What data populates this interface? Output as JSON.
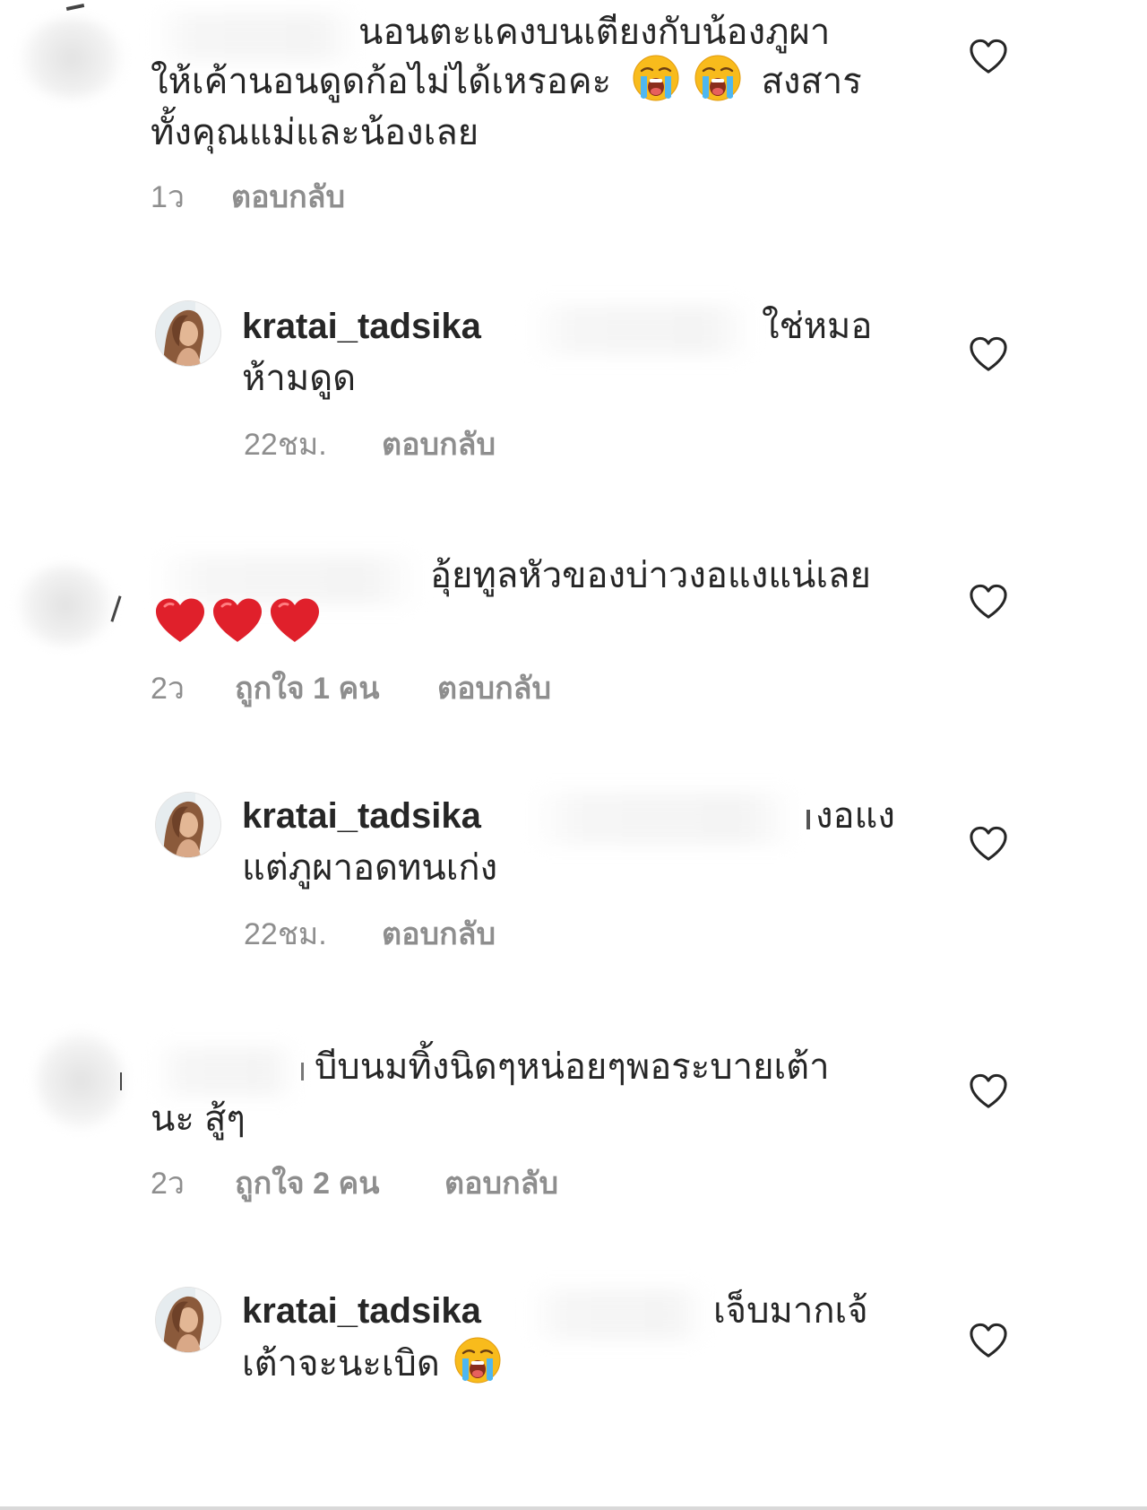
{
  "comments": [
    {
      "lines": [
        "นอนตะแคงบนเตียงกับน้องภูผา",
        "ให้เค้านอนดูดก้อไม่ได้เหรอคะ",
        "สงสาร",
        "ทั้งคุณแม่และน้องเลย"
      ],
      "time": "1ว",
      "reply_label": "ตอบกลับ"
    },
    {
      "username": "kratai_tadsika",
      "lines": [
        "ใช่หมอ",
        "ห้ามดูด"
      ],
      "time": "22ชม.",
      "reply_label": "ตอบกลับ"
    },
    {
      "lines": [
        "อุ้ยทูลหัวของบ่าวงอแงแน่เลย"
      ],
      "time": "2ว",
      "likes": "ถูกใจ 1 คน",
      "reply_label": "ตอบกลับ"
    },
    {
      "username": "kratai_tadsika",
      "lines": [
        "งอแง",
        "แต่ภูผาอดทนเก่ง"
      ],
      "time": "22ชม.",
      "reply_label": "ตอบกลับ"
    },
    {
      "lines": [
        "บีบนมทิ้งนิดๆหน่อยๆพอระบายเต้า",
        "นะ สู้ๆ"
      ],
      "time": "2ว",
      "likes": "ถูกใจ 2 คน",
      "reply_label": "ตอบกลับ"
    },
    {
      "username": "kratai_tadsika",
      "lines": [
        "เจ็บมากเจ้",
        "เต้าจะนะเบิด"
      ]
    }
  ],
  "icons": {
    "like": "heart-outline-icon",
    "cry": "loudly-crying-face-emoji",
    "red_heart": "red-heart-emoji"
  },
  "colors": {
    "text": "#262626",
    "meta": "#8e8e8e",
    "heart_stroke": "#262626",
    "emoji_heart": "#e0202b",
    "emoji_face": "#f8bb1c"
  }
}
